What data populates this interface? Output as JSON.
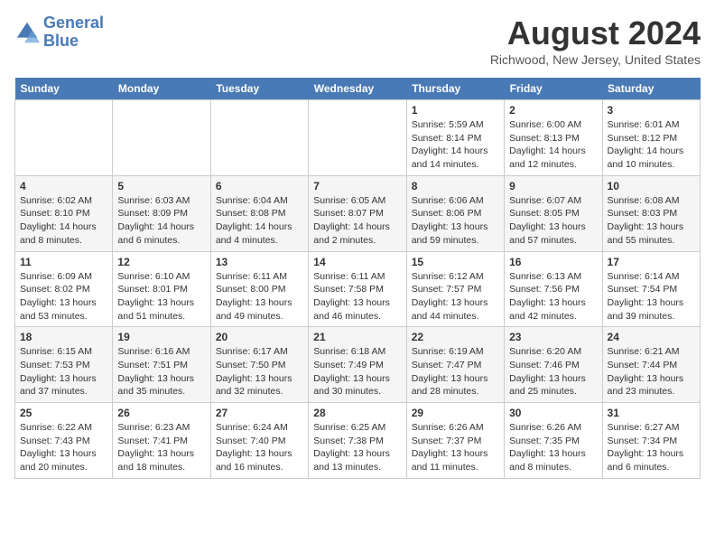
{
  "header": {
    "logo_line1": "General",
    "logo_line2": "Blue",
    "month_title": "August 2024",
    "location": "Richwood, New Jersey, United States"
  },
  "weekdays": [
    "Sunday",
    "Monday",
    "Tuesday",
    "Wednesday",
    "Thursday",
    "Friday",
    "Saturday"
  ],
  "weeks": [
    [
      {
        "day": "",
        "info": ""
      },
      {
        "day": "",
        "info": ""
      },
      {
        "day": "",
        "info": ""
      },
      {
        "day": "",
        "info": ""
      },
      {
        "day": "1",
        "sunrise": "Sunrise: 5:59 AM",
        "sunset": "Sunset: 8:14 PM",
        "daylight": "Daylight: 14 hours and 14 minutes."
      },
      {
        "day": "2",
        "sunrise": "Sunrise: 6:00 AM",
        "sunset": "Sunset: 8:13 PM",
        "daylight": "Daylight: 14 hours and 12 minutes."
      },
      {
        "day": "3",
        "sunrise": "Sunrise: 6:01 AM",
        "sunset": "Sunset: 8:12 PM",
        "daylight": "Daylight: 14 hours and 10 minutes."
      }
    ],
    [
      {
        "day": "4",
        "sunrise": "Sunrise: 6:02 AM",
        "sunset": "Sunset: 8:10 PM",
        "daylight": "Daylight: 14 hours and 8 minutes."
      },
      {
        "day": "5",
        "sunrise": "Sunrise: 6:03 AM",
        "sunset": "Sunset: 8:09 PM",
        "daylight": "Daylight: 14 hours and 6 minutes."
      },
      {
        "day": "6",
        "sunrise": "Sunrise: 6:04 AM",
        "sunset": "Sunset: 8:08 PM",
        "daylight": "Daylight: 14 hours and 4 minutes."
      },
      {
        "day": "7",
        "sunrise": "Sunrise: 6:05 AM",
        "sunset": "Sunset: 8:07 PM",
        "daylight": "Daylight: 14 hours and 2 minutes."
      },
      {
        "day": "8",
        "sunrise": "Sunrise: 6:06 AM",
        "sunset": "Sunset: 8:06 PM",
        "daylight": "Daylight: 13 hours and 59 minutes."
      },
      {
        "day": "9",
        "sunrise": "Sunrise: 6:07 AM",
        "sunset": "Sunset: 8:05 PM",
        "daylight": "Daylight: 13 hours and 57 minutes."
      },
      {
        "day": "10",
        "sunrise": "Sunrise: 6:08 AM",
        "sunset": "Sunset: 8:03 PM",
        "daylight": "Daylight: 13 hours and 55 minutes."
      }
    ],
    [
      {
        "day": "11",
        "sunrise": "Sunrise: 6:09 AM",
        "sunset": "Sunset: 8:02 PM",
        "daylight": "Daylight: 13 hours and 53 minutes."
      },
      {
        "day": "12",
        "sunrise": "Sunrise: 6:10 AM",
        "sunset": "Sunset: 8:01 PM",
        "daylight": "Daylight: 13 hours and 51 minutes."
      },
      {
        "day": "13",
        "sunrise": "Sunrise: 6:11 AM",
        "sunset": "Sunset: 8:00 PM",
        "daylight": "Daylight: 13 hours and 49 minutes."
      },
      {
        "day": "14",
        "sunrise": "Sunrise: 6:11 AM",
        "sunset": "Sunset: 7:58 PM",
        "daylight": "Daylight: 13 hours and 46 minutes."
      },
      {
        "day": "15",
        "sunrise": "Sunrise: 6:12 AM",
        "sunset": "Sunset: 7:57 PM",
        "daylight": "Daylight: 13 hours and 44 minutes."
      },
      {
        "day": "16",
        "sunrise": "Sunrise: 6:13 AM",
        "sunset": "Sunset: 7:56 PM",
        "daylight": "Daylight: 13 hours and 42 minutes."
      },
      {
        "day": "17",
        "sunrise": "Sunrise: 6:14 AM",
        "sunset": "Sunset: 7:54 PM",
        "daylight": "Daylight: 13 hours and 39 minutes."
      }
    ],
    [
      {
        "day": "18",
        "sunrise": "Sunrise: 6:15 AM",
        "sunset": "Sunset: 7:53 PM",
        "daylight": "Daylight: 13 hours and 37 minutes."
      },
      {
        "day": "19",
        "sunrise": "Sunrise: 6:16 AM",
        "sunset": "Sunset: 7:51 PM",
        "daylight": "Daylight: 13 hours and 35 minutes."
      },
      {
        "day": "20",
        "sunrise": "Sunrise: 6:17 AM",
        "sunset": "Sunset: 7:50 PM",
        "daylight": "Daylight: 13 hours and 32 minutes."
      },
      {
        "day": "21",
        "sunrise": "Sunrise: 6:18 AM",
        "sunset": "Sunset: 7:49 PM",
        "daylight": "Daylight: 13 hours and 30 minutes."
      },
      {
        "day": "22",
        "sunrise": "Sunrise: 6:19 AM",
        "sunset": "Sunset: 7:47 PM",
        "daylight": "Daylight: 13 hours and 28 minutes."
      },
      {
        "day": "23",
        "sunrise": "Sunrise: 6:20 AM",
        "sunset": "Sunset: 7:46 PM",
        "daylight": "Daylight: 13 hours and 25 minutes."
      },
      {
        "day": "24",
        "sunrise": "Sunrise: 6:21 AM",
        "sunset": "Sunset: 7:44 PM",
        "daylight": "Daylight: 13 hours and 23 minutes."
      }
    ],
    [
      {
        "day": "25",
        "sunrise": "Sunrise: 6:22 AM",
        "sunset": "Sunset: 7:43 PM",
        "daylight": "Daylight: 13 hours and 20 minutes."
      },
      {
        "day": "26",
        "sunrise": "Sunrise: 6:23 AM",
        "sunset": "Sunset: 7:41 PM",
        "daylight": "Daylight: 13 hours and 18 minutes."
      },
      {
        "day": "27",
        "sunrise": "Sunrise: 6:24 AM",
        "sunset": "Sunset: 7:40 PM",
        "daylight": "Daylight: 13 hours and 16 minutes."
      },
      {
        "day": "28",
        "sunrise": "Sunrise: 6:25 AM",
        "sunset": "Sunset: 7:38 PM",
        "daylight": "Daylight: 13 hours and 13 minutes."
      },
      {
        "day": "29",
        "sunrise": "Sunrise: 6:26 AM",
        "sunset": "Sunset: 7:37 PM",
        "daylight": "Daylight: 13 hours and 11 minutes."
      },
      {
        "day": "30",
        "sunrise": "Sunrise: 6:26 AM",
        "sunset": "Sunset: 7:35 PM",
        "daylight": "Daylight: 13 hours and 8 minutes."
      },
      {
        "day": "31",
        "sunrise": "Sunrise: 6:27 AM",
        "sunset": "Sunset: 7:34 PM",
        "daylight": "Daylight: 13 hours and 6 minutes."
      }
    ]
  ]
}
